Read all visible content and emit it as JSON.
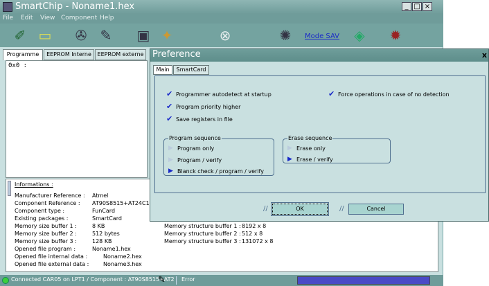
{
  "window": {
    "title": "SmartChip - Noname1.hex",
    "controls": {
      "minimize": "_",
      "maximize": "□",
      "close": "×"
    }
  },
  "menu": [
    "File",
    "Edit",
    "View",
    "Component",
    "Help"
  ],
  "toolbar": {
    "buttons": [
      "open-icon",
      "new-icon",
      "read-chip-icon",
      "write-chip-icon",
      "program-icon",
      "erase-icon",
      "stop-icon",
      "settings-icon",
      "chip-icon",
      "bug-icon"
    ],
    "mode_label": "Mode SAV"
  },
  "tabs": [
    "Programme",
    "EEPROM Interne",
    "EEPROM externe"
  ],
  "editor": {
    "address": "0x0 :"
  },
  "info": {
    "title": "Informations :",
    "rows": [
      {
        "label": "Manufacturer Reference :",
        "value": "Atmel"
      },
      {
        "label": "Component Reference :",
        "value": "AT90S8515+AT24C1024"
      },
      {
        "label": "Component type :",
        "value": "FunCard"
      },
      {
        "label": "Existing packages :",
        "value": "SmartCard"
      },
      {
        "label": "Memory size buffer 1 :",
        "value": "8 KB"
      },
      {
        "label": "Memory size buffer 2 :",
        "value": "512 bytes"
      },
      {
        "label": "Memory size buffer 3 :",
        "value": "128 KB"
      },
      {
        "label": "Opened file program :",
        "value": "Noname1.hex"
      },
      {
        "label": "Opened file internal data :",
        "value": "Noname2.hex"
      },
      {
        "label": "Opened file external data :",
        "value": "Noname3.hex"
      }
    ],
    "structure": [
      {
        "label": "Memory structure buffer 1 :",
        "value": "8192 x 8"
      },
      {
        "label": "Memory structure buffer 2 :",
        "value": "512 x 8"
      },
      {
        "label": "Memory structure buffer 3 :",
        "value": "131072 x 8"
      }
    ]
  },
  "status": {
    "connection": "Connected CAR05 on LPT1 / Component : AT90S8515+AT2",
    "error": "Error"
  },
  "preference": {
    "title": "Preference",
    "close": "x",
    "tabs": [
      "Main",
      "SmartCard"
    ],
    "checkboxes": [
      {
        "label": "Programmer autodetect at startup",
        "checked": true
      },
      {
        "label": "Program priority higher",
        "checked": true
      },
      {
        "label": "Save registers in file",
        "checked": true
      },
      {
        "label": "Force operations in case of no detection",
        "checked": true
      }
    ],
    "program_sequence": {
      "title": "Program sequence",
      "options": [
        {
          "label": "Program only",
          "selected": false
        },
        {
          "label": "Program / verify",
          "selected": false
        },
        {
          "label": "Blanck check / program / verify",
          "selected": true
        }
      ]
    },
    "erase_sequence": {
      "title": "Erase sequence",
      "options": [
        {
          "label": "Erase only",
          "selected": false
        },
        {
          "label": "Erase / verify",
          "selected": true
        }
      ]
    },
    "ok_label": "OK",
    "cancel_label": "Cancel"
  }
}
